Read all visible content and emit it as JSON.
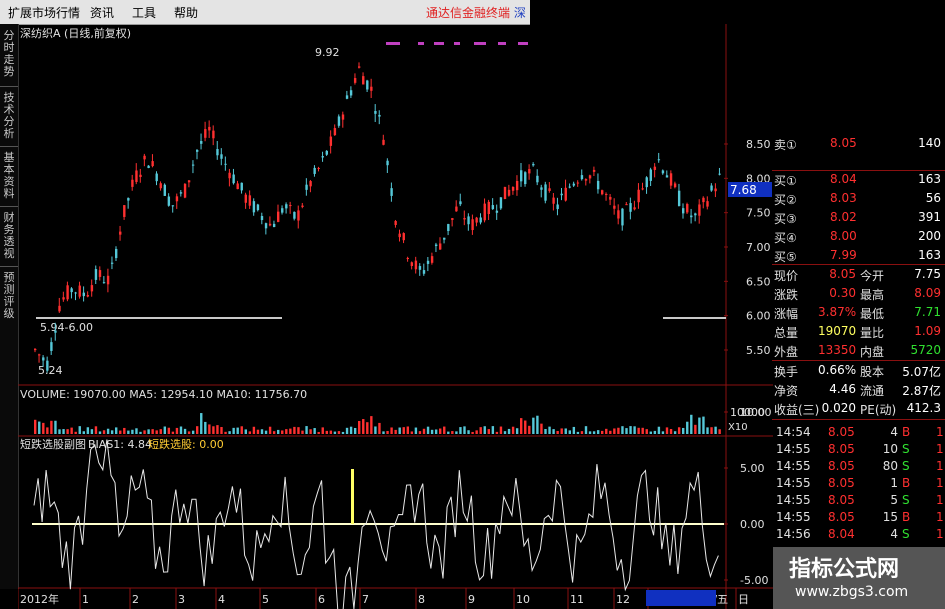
{
  "menu": {
    "items": [
      "扩展市场行情",
      "资讯",
      "工具",
      "帮助"
    ]
  },
  "banner": "通达信金融终端",
  "banner_tail": "深",
  "side_tabs": [
    "分时走势",
    "技术分析",
    "基本资料",
    "财务透视",
    "预测评级"
  ],
  "chart": {
    "stock_title": "深纺织A (日线,前复权)",
    "price_high_label": "9.92",
    "price_low_label": "5.24",
    "range_label": "5.94-6.00",
    "current_price_tag": "7.68",
    "price_ticks": [
      "8.50",
      "8.00",
      "7.50",
      "7.00",
      "6.50",
      "6.00",
      "5.50"
    ],
    "volume_label": "VOLUME: 19070.00  MA5: 12954.10  MA10: 11756.70",
    "volume_ticks": [
      "10000",
      "X10"
    ],
    "indicator_name": "短跌选股副图",
    "indicator_bias": "BIAS1: 4.84",
    "indicator_extra": "短跌选股: 0.00",
    "indicator_ticks": [
      "10.00",
      "5.00",
      "0.00",
      "-5.00"
    ],
    "date_labels": [
      "2012年",
      "1",
      "2",
      "3",
      "4",
      "5",
      "6",
      "7",
      "8",
      "9",
      "10",
      "11",
      "12",
      "2014/01/24/五",
      "日"
    ],
    "colors": {
      "up": "#ff3030",
      "down": "#55c8d8",
      "flat_line": "#ffffcc",
      "axis": "#8a1010"
    }
  },
  "quote": {
    "sell_top": [
      {
        "label": "卖①",
        "price": "8.05",
        "vol": "140"
      }
    ],
    "buy": [
      {
        "label": "买①",
        "price": "8.04",
        "vol": "163"
      },
      {
        "label": "买②",
        "price": "8.03",
        "vol": "56"
      },
      {
        "label": "买③",
        "price": "8.02",
        "vol": "391"
      },
      {
        "label": "买④",
        "price": "8.00",
        "vol": "200"
      },
      {
        "label": "买⑤",
        "price": "7.99",
        "vol": "163"
      }
    ],
    "fields": [
      {
        "l1": "现价",
        "v1": "8.05",
        "l2": "今开",
        "v2": "7.75"
      },
      {
        "l1": "涨跌",
        "v1": "0.30",
        "l2": "最高",
        "v2": "8.09"
      },
      {
        "l1": "涨幅",
        "v1": "3.87%",
        "l2": "最低",
        "v2": "7.71"
      },
      {
        "l1": "总量",
        "v1": "19070",
        "l2": "量比",
        "v2": "1.09"
      },
      {
        "l1": "外盘",
        "v1": "13350",
        "l2": "内盘",
        "v2": "5720"
      }
    ],
    "fields2": [
      {
        "l1": "换手",
        "v1": "0.66%",
        "l2": "股本",
        "v2": "5.07亿"
      },
      {
        "l1": "净资",
        "v1": "4.46",
        "l2": "流通",
        "v2": "2.87亿"
      },
      {
        "l1": "收益(三)",
        "v1": "0.020",
        "l2": "PE(动)",
        "v2": "412.3"
      }
    ],
    "ticks": [
      {
        "time": "14:54",
        "price": "8.05",
        "vol": "4",
        "flag": "B",
        "x": "1"
      },
      {
        "time": "14:55",
        "price": "8.05",
        "vol": "10",
        "flag": "S",
        "x": "1"
      },
      {
        "time": "14:55",
        "price": "8.05",
        "vol": "80",
        "flag": "S",
        "x": "1"
      },
      {
        "time": "14:55",
        "price": "8.05",
        "vol": "1",
        "flag": "B",
        "x": "1"
      },
      {
        "time": "14:55",
        "price": "8.05",
        "vol": "5",
        "flag": "S",
        "x": "1"
      },
      {
        "time": "14:55",
        "price": "8.05",
        "vol": "15",
        "flag": "B",
        "x": "1"
      },
      {
        "time": "14:56",
        "price": "8.04",
        "vol": "4",
        "flag": "S",
        "x": "1"
      }
    ]
  },
  "watermark": {
    "title": "指标公式网",
    "url": "www.zbgs3.com"
  }
}
